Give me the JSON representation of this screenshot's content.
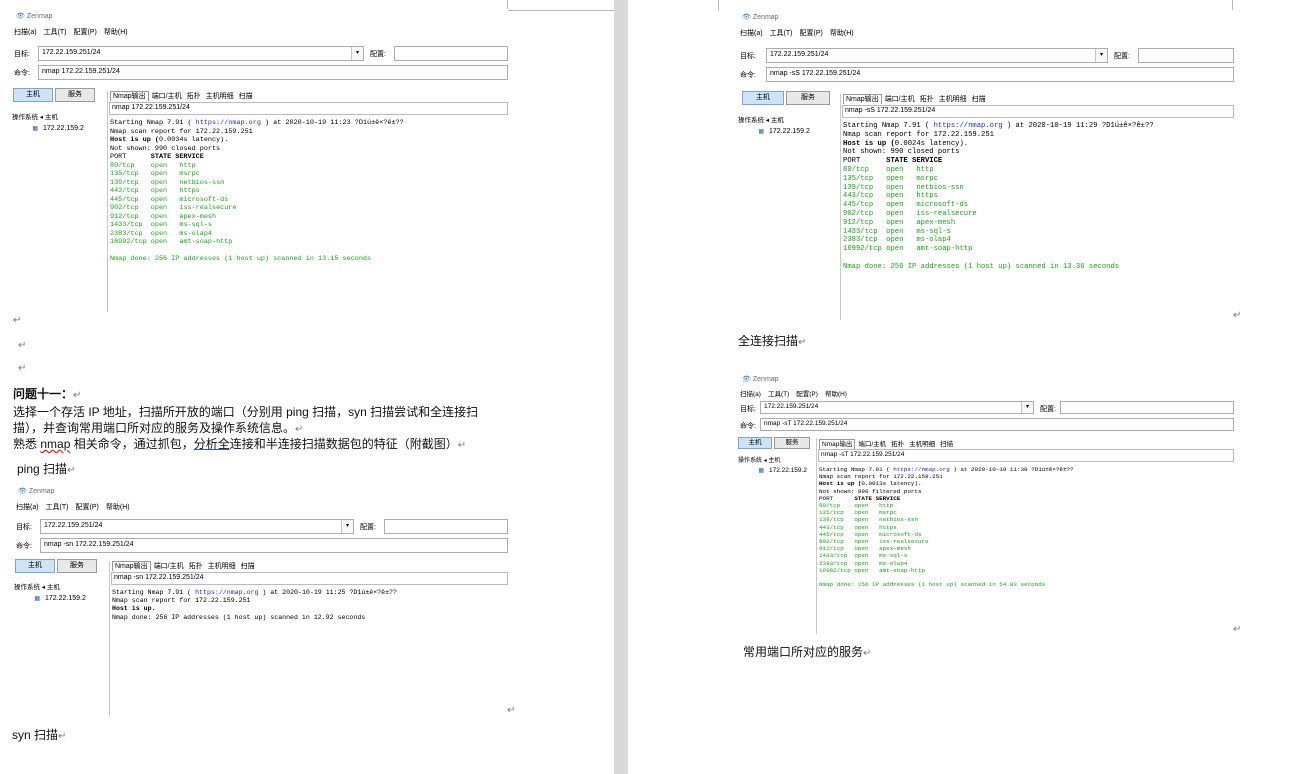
{
  "zenmap": {
    "app_title": "Zenmap",
    "menu": [
      "扫描(a)",
      "工具(T)",
      "配置(P)",
      "帮助(H)"
    ],
    "target_label": "目标:",
    "target_value": "172.22.159.251/24",
    "profile_label": "配置:",
    "command_label": "命令:",
    "hosts_btn": "主机",
    "services_btn": "服务",
    "os_header": "操作系统 ◂ 主机",
    "host_entry": "172.22.159.2",
    "tabs": [
      "Nmap输出",
      "端口/主机",
      "拓扑",
      "主机明细",
      "扫描"
    ]
  },
  "screenshots": {
    "top_left": {
      "command": "nmap 172.22.159.251/24",
      "time": "11:23",
      "latency": "0.0034s",
      "not_shown": "990 closed ports",
      "duration": "13.15"
    },
    "top_right": {
      "command": "nmap -sS 172.22.159.251/24",
      "time": "11:29",
      "latency": "0.0024s",
      "not_shown": "990 closed ports",
      "duration": "13.36"
    },
    "bottom_right": {
      "command": "nmap -sT 172.22.159.251/24",
      "time": "11:30",
      "latency": "0.0013s",
      "not_shown": "990 filtered ports",
      "duration": "54.83"
    },
    "bottom_left": {
      "command": "nmap -sn 172.22.159.251/24",
      "time": "11:25",
      "duration": "12.92"
    }
  },
  "nmap_output": {
    "start_prefix": "Starting Nmap 7.91 ( ",
    "url": "https://nmap.org",
    "at_prefix": " ) at 2020-10-19 ",
    "garbled": " ?D1ú±ê×?ê±??",
    "report_line": "Nmap scan report for 172.22.159.251",
    "host_up_prefix": "Host is up (",
    "host_up_suffix": " latency).",
    "host_up_only": "Host is up.",
    "not_shown_prefix": "Not shown: ",
    "header_port": "PORT      ",
    "header_state": "STATE SERVICE",
    "ports": [
      {
        "port": "80/tcp   ",
        "state": "open",
        "service": "http"
      },
      {
        "port": "135/tcp  ",
        "state": "open",
        "service": "msrpc"
      },
      {
        "port": "139/tcp  ",
        "state": "open",
        "service": "netbios-ssn"
      },
      {
        "port": "443/tcp  ",
        "state": "open",
        "service": "https"
      },
      {
        "port": "445/tcp  ",
        "state": "open",
        "service": "microsoft-ds"
      },
      {
        "port": "902/tcp  ",
        "state": "open",
        "service": "iss-realsecure"
      },
      {
        "port": "912/tcp  ",
        "state": "open",
        "service": "apex-mesh"
      },
      {
        "port": "1433/tcp ",
        "state": "open",
        "service": "ms-sql-s"
      },
      {
        "port": "2383/tcp ",
        "state": "open",
        "service": "ms-olap4"
      },
      {
        "port": "16992/tcp",
        "state": "open",
        "service": "amt-soap-http"
      }
    ],
    "done_prefix": "Nmap done: 256 IP addresses (1 host up) scanned in ",
    "done_suffix": " seconds"
  },
  "doc": {
    "question_title": "问题十一：",
    "para1_line1": "选择一个存活 IP 地址，扫描所开放的端口（分别用 ping 扫描，syn 扫描尝试和全连接扫",
    "para1_line2": "描），并查询常用端口所对应的服务及操作系统信息。",
    "para2_a": "熟悉 ",
    "para2_nmap": "nmap",
    "para2_b": " 相关命令，通过抓包，",
    "para2_c": "分析全",
    "para2_d": "连接和半连接扫描数据包的特征（附截图）",
    "caption_ping": "ping 扫描",
    "caption_syn": "syn 扫描",
    "caption_full": "全连接扫描",
    "caption_services": "常用端口所对应的服务",
    "return_mark": "↵"
  }
}
